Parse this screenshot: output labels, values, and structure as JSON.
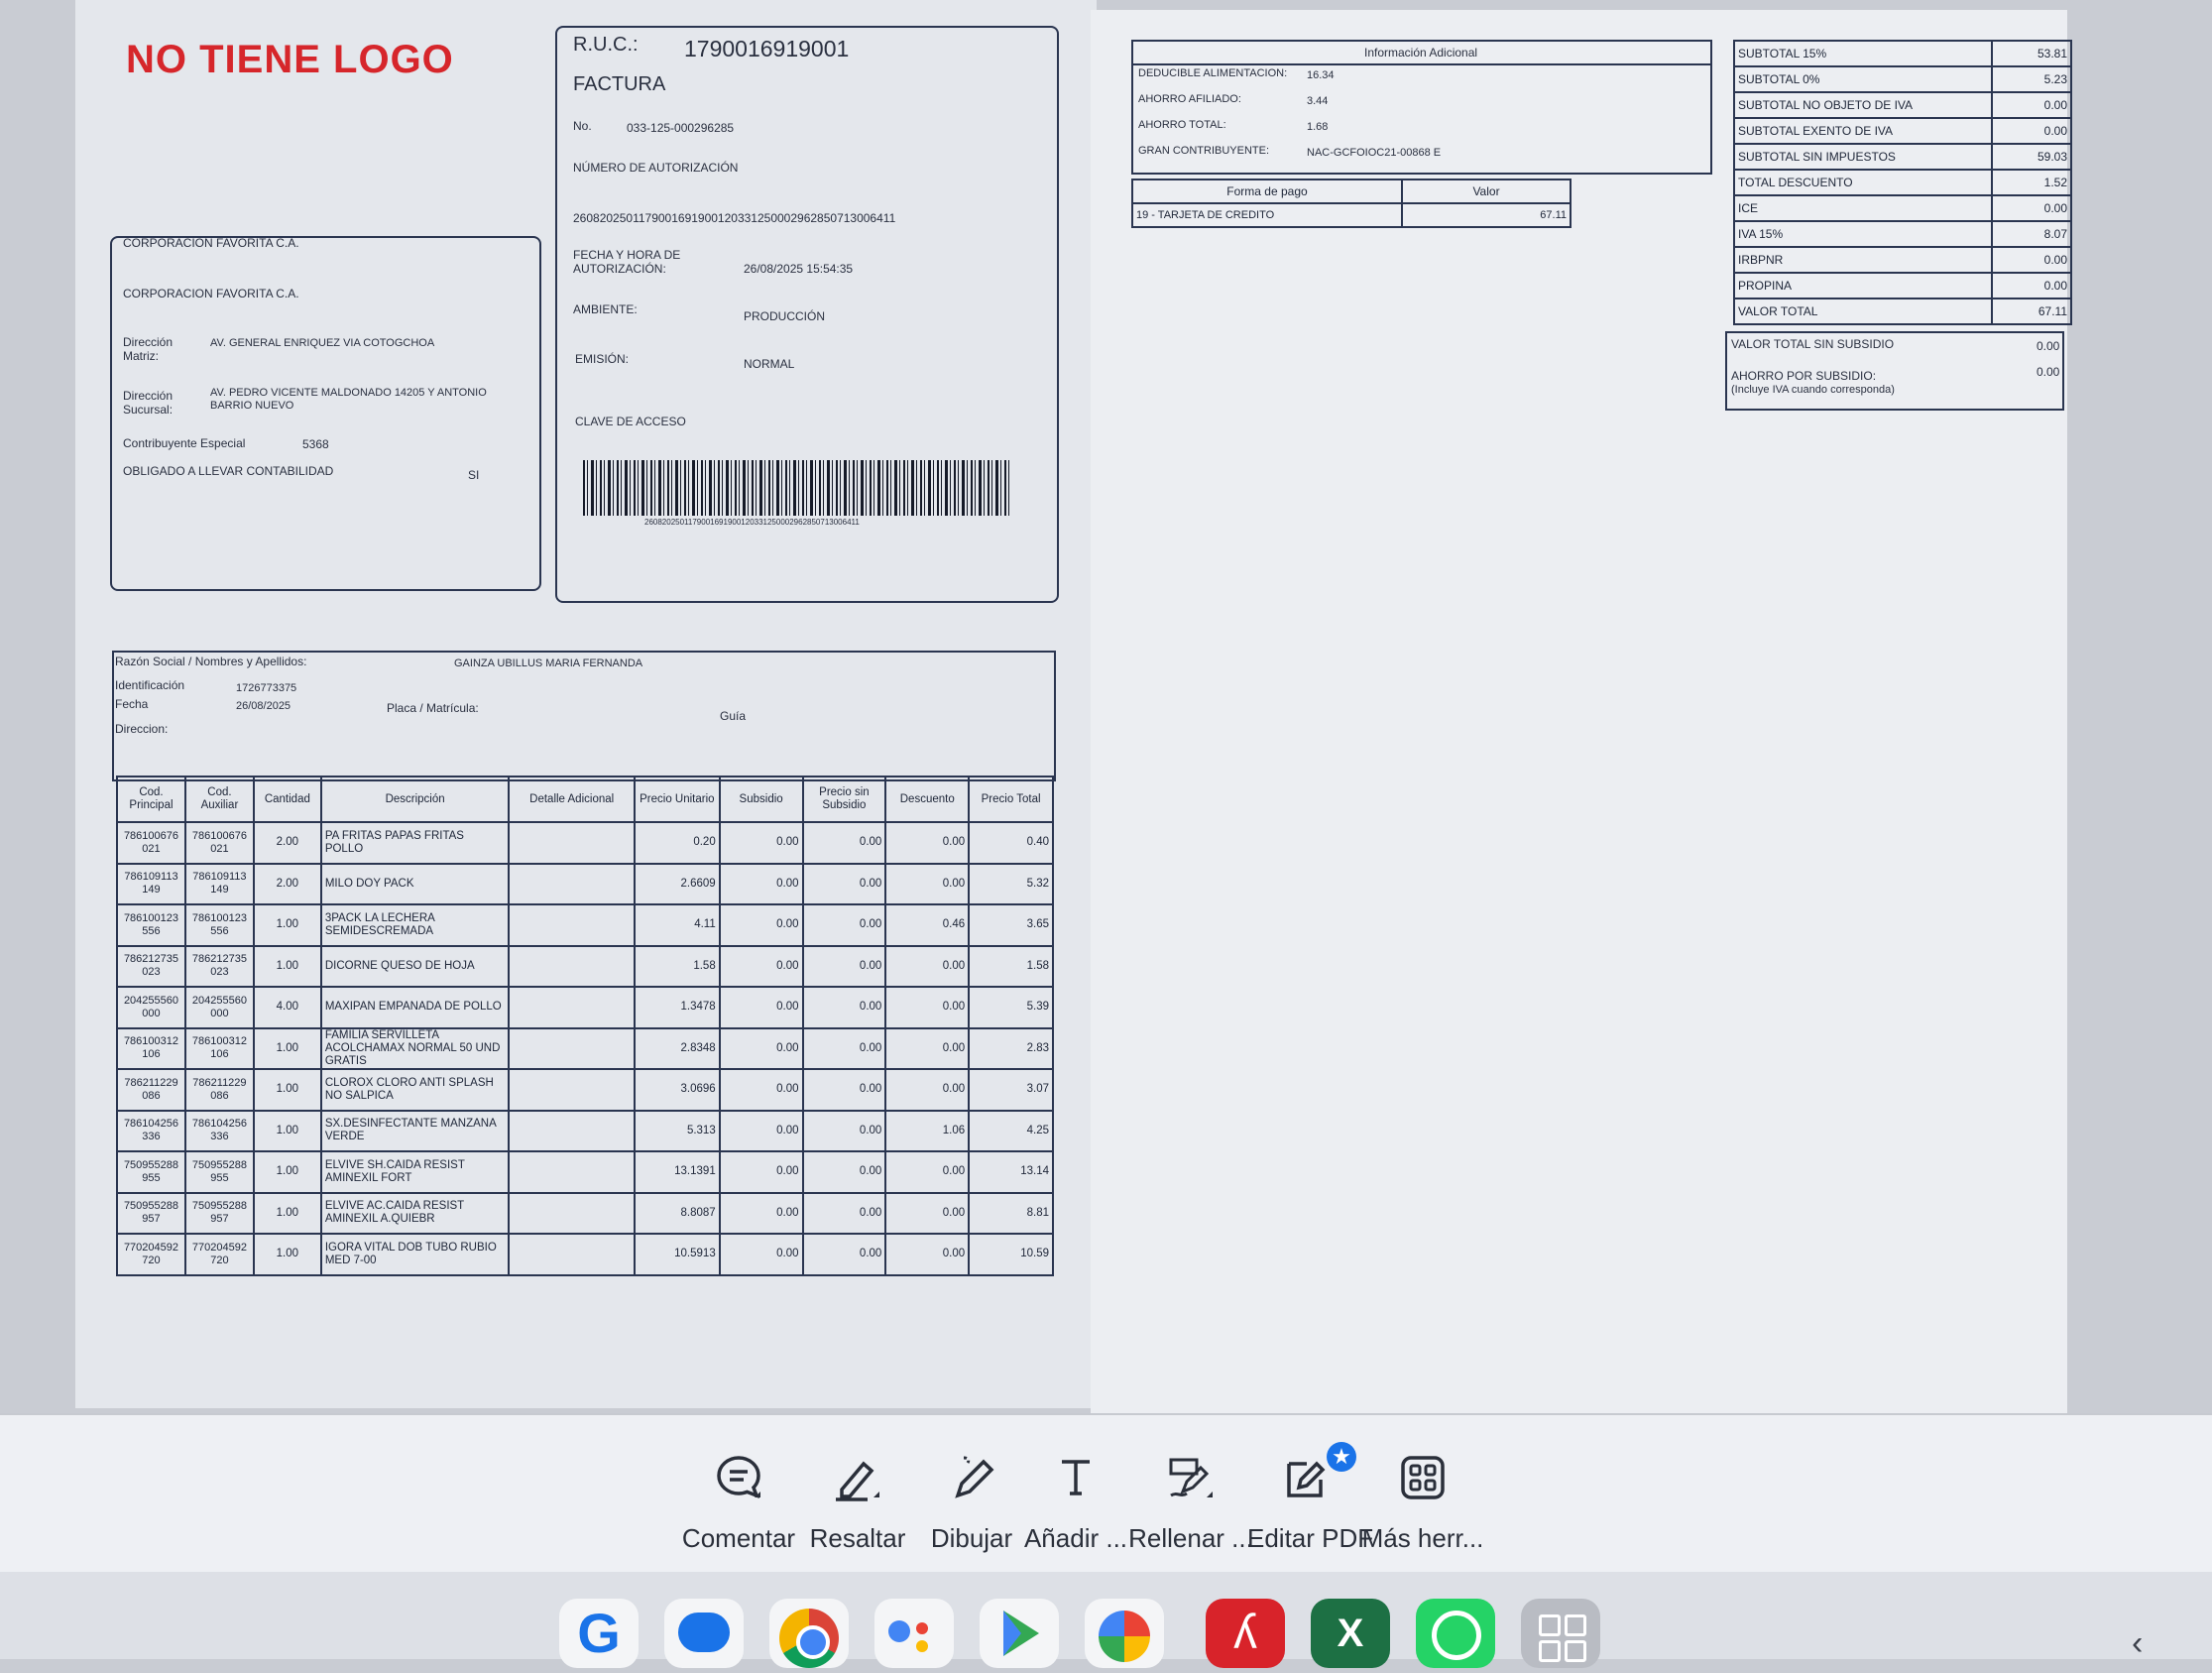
{
  "invoice": {
    "logo_text": "NO TIENE LOGO",
    "ruc_label": "R.U.C.:",
    "ruc_value": "1790016919001",
    "doc_type": "FACTURA",
    "no_label": "No.",
    "no_value": "033-125-000296285",
    "auth_label": "NÚMERO DE AUTORIZACIÓN",
    "auth_value": "2608202501179001691900120331250002962850713006411",
    "auth_date_label": "FECHA Y HORA DE AUTORIZACIÓN:",
    "auth_date_value": "26/08/2025 15:54:35",
    "env_label": "AMBIENTE:",
    "env_value": "PRODUCCIÓN",
    "emission_label": "EMISIÓN:",
    "emission_value": "NORMAL",
    "access_key_label": "CLAVE DE ACCESO",
    "access_key_value": "2608202501179001691900120331250002962850713006411",
    "company_name_1": "CORPORACION FAVORITA C.A.",
    "company_name_2": "CORPORACION FAVORITA C.A.",
    "matriz_label": "Dirección Matriz:",
    "matriz_value": "AV. GENERAL ENRIQUEZ VIA COTOGCHOA",
    "sucursal_label": "Dirección Sucursal:",
    "sucursal_value_1": "AV. PEDRO VICENTE MALDONADO 14205 Y ANTONIO",
    "sucursal_value_2": "BARRIO NUEVO",
    "contrib_label": "Contribuyente Especial",
    "contrib_value": "5368",
    "obligado_label": "OBLIGADO A LLEVAR CONTABILIDAD",
    "obligado_value": "SI"
  },
  "customer": {
    "name_label": "Razón Social / Nombres y Apellidos:",
    "name_value": "GAINZA UBILLUS MARIA FERNANDA",
    "id_label": "Identificación",
    "id_value": "1726773375",
    "date_label": "Fecha",
    "date_value": "26/08/2025",
    "plate_label": "Placa / Matrícula:",
    "guide_label": "Guía",
    "address_label": "Direccion:"
  },
  "items_table": {
    "headers": [
      "Cod. Principal",
      "Cod. Auxiliar",
      "Cantidad",
      "Descripción",
      "Detalle Adicional",
      "Precio Unitario",
      "Subsidio",
      "Precio sin Subsidio",
      "Descuento",
      "Precio Total"
    ],
    "rows": [
      [
        "786100676 021",
        "786100676 021",
        "2.00",
        "PA FRITAS PAPAS FRITAS POLLO",
        "",
        "0.20",
        "0.00",
        "0.00",
        "0.00",
        "0.40"
      ],
      [
        "786109113 149",
        "786109113 149",
        "2.00",
        "MILO DOY PACK",
        "",
        "2.6609",
        "0.00",
        "0.00",
        "0.00",
        "5.32"
      ],
      [
        "786100123 556",
        "786100123 556",
        "1.00",
        "3PACK LA LECHERA SEMIDESCREMADA",
        "",
        "4.11",
        "0.00",
        "0.00",
        "0.46",
        "3.65"
      ],
      [
        "786212735 023",
        "786212735 023",
        "1.00",
        "DICORNE QUESO DE HOJA",
        "",
        "1.58",
        "0.00",
        "0.00",
        "0.00",
        "1.58"
      ],
      [
        "204255560 000",
        "204255560 000",
        "4.00",
        "MAXIPAN EMPANADA DE POLLO",
        "",
        "1.3478",
        "0.00",
        "0.00",
        "0.00",
        "5.39"
      ],
      [
        "786100312 106",
        "786100312 106",
        "1.00",
        "FAMILIA SERVILLETA ACOLCHAMAX NORMAL 50 UND GRATIS",
        "",
        "2.8348",
        "0.00",
        "0.00",
        "0.00",
        "2.83"
      ],
      [
        "786211229 086",
        "786211229 086",
        "1.00",
        "CLOROX CLORO ANTI SPLASH NO SALPICA",
        "",
        "3.0696",
        "0.00",
        "0.00",
        "0.00",
        "3.07"
      ],
      [
        "786104256 336",
        "786104256 336",
        "1.00",
        "SX.DESINFECTANTE MANZANA VERDE",
        "",
        "5.313",
        "0.00",
        "0.00",
        "1.06",
        "4.25"
      ],
      [
        "750955288 955",
        "750955288 955",
        "1.00",
        "ELVIVE SH.CAIDA RESIST AMINEXIL FORT",
        "",
        "13.1391",
        "0.00",
        "0.00",
        "0.00",
        "13.14"
      ],
      [
        "750955288 957",
        "750955288 957",
        "1.00",
        "ELVIVE AC.CAIDA RESIST AMINEXIL A.QUIEBR",
        "",
        "8.8087",
        "0.00",
        "0.00",
        "0.00",
        "8.81"
      ],
      [
        "770204592 720",
        "770204592 720",
        "1.00",
        "IGORA VITAL DOB TUBO RUBIO MED 7-00",
        "",
        "10.5913",
        "0.00",
        "0.00",
        "0.00",
        "10.59"
      ]
    ]
  },
  "additional_info": {
    "title": "Información Adicional",
    "rows": [
      {
        "label": "DEDUCIBLE ALIMENTACION:",
        "value": "16.34"
      },
      {
        "label": "AHORRO AFILIADO:",
        "value": "3.44"
      },
      {
        "label": "AHORRO TOTAL:",
        "value": "1.68"
      },
      {
        "label": "GRAN CONTRIBUYENTE:",
        "value": "NAC-GCFOIOC21-00868 E"
      }
    ]
  },
  "payments": {
    "headers": [
      "Forma de pago",
      "Valor"
    ],
    "rows": [
      [
        "19 - TARJETA DE CREDITO",
        "67.11"
      ]
    ]
  },
  "totals": {
    "rows": [
      [
        "SUBTOTAL 15%",
        "53.81"
      ],
      [
        "SUBTOTAL 0%",
        "5.23"
      ],
      [
        "SUBTOTAL NO OBJETO DE IVA",
        "0.00"
      ],
      [
        "SUBTOTAL EXENTO DE IVA",
        "0.00"
      ],
      [
        "SUBTOTAL SIN IMPUESTOS",
        "59.03"
      ],
      [
        "TOTAL DESCUENTO",
        "1.52"
      ],
      [
        "ICE",
        "0.00"
      ],
      [
        "IVA 15%",
        "8.07"
      ],
      [
        "IRBPNR",
        "0.00"
      ],
      [
        "PROPINA",
        "0.00"
      ],
      [
        "VALOR TOTAL",
        "67.11"
      ]
    ],
    "sin_subsidio_label": "VALOR TOTAL SIN SUBSIDIO",
    "sin_subsidio_value": "0.00",
    "ahorro_label": "AHORRO POR SUBSIDIO:",
    "ahorro_sub": "(Incluye IVA cuando corresponda)",
    "ahorro_value": "0.00"
  },
  "toolbar": {
    "tools": [
      {
        "label": "Comentar",
        "icon": "comment-icon"
      },
      {
        "label": "Resaltar",
        "icon": "highlighter-icon"
      },
      {
        "label": "Dibujar",
        "icon": "pencil-draw-icon"
      },
      {
        "label": "Añadir ...",
        "icon": "text-icon"
      },
      {
        "label": "Rellenar ...",
        "icon": "fill-sign-icon"
      },
      {
        "label": "Editar PDF",
        "icon": "edit-pdf-icon"
      },
      {
        "label": "Más herr...",
        "icon": "more-tools-grid-icon"
      }
    ]
  },
  "taskbar": {
    "apps": [
      "google-icon",
      "messages-icon",
      "chrome-icon",
      "assistant-icon",
      "play-store-icon",
      "photos-icon",
      "acrobat-icon",
      "excel-icon",
      "whatsapp-icon",
      "app-drawer-icon"
    ],
    "colors": {
      "accent_blue": "#1a73e8",
      "acrobat_red": "#d8232a",
      "excel_green": "#1d7044",
      "whatsapp_green": "#25d366"
    }
  }
}
